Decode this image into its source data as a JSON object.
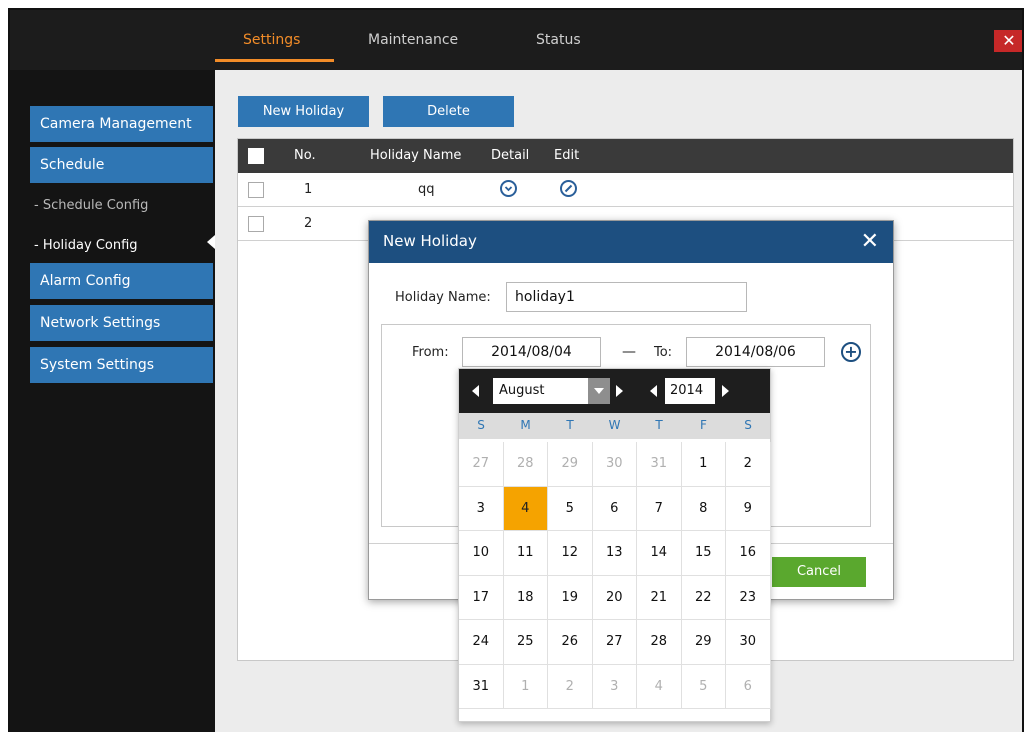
{
  "topbar": {
    "tabs": [
      "Settings",
      "Maintenance",
      "Status"
    ],
    "active_tab": "Settings",
    "close_label": "✕"
  },
  "sidebar": {
    "items": [
      {
        "label": "Camera Management"
      },
      {
        "label": "Schedule"
      },
      {
        "label": "- Schedule Config"
      },
      {
        "label": "- Holiday Config"
      },
      {
        "label": "Alarm Config"
      },
      {
        "label": "Network Settings"
      },
      {
        "label": "System Settings"
      }
    ]
  },
  "toolbar": {
    "new_holiday": "New Holiday",
    "delete": "Delete"
  },
  "table": {
    "headers": [
      "No.",
      "Holiday Name",
      "Detail",
      "Edit"
    ],
    "rows": [
      {
        "no": "1",
        "name": "qq"
      },
      {
        "no": "2",
        "name": ""
      }
    ]
  },
  "modal": {
    "title": "New Holiday",
    "close": "✕",
    "name_label": "Holiday Name:",
    "name_value": "holiday1",
    "from_label": "From:",
    "from_value": "2014/08/04",
    "dash": "—",
    "to_label": "To:",
    "to_value": "2014/08/06",
    "plus": "+",
    "cancel": "Cancel"
  },
  "calendar": {
    "month": "August",
    "year": "2014",
    "dow": [
      "S",
      "M",
      "T",
      "W",
      "T",
      "F",
      "S"
    ],
    "weeks": [
      [
        "27",
        "28",
        "29",
        "30",
        "31",
        "1",
        "2"
      ],
      [
        "3",
        "4",
        "5",
        "6",
        "7",
        "8",
        "9"
      ],
      [
        "10",
        "11",
        "12",
        "13",
        "14",
        "15",
        "16"
      ],
      [
        "17",
        "18",
        "19",
        "20",
        "21",
        "22",
        "23"
      ],
      [
        "24",
        "25",
        "26",
        "27",
        "28",
        "29",
        "30"
      ],
      [
        "31",
        "1",
        "2",
        "3",
        "4",
        "5",
        "6"
      ]
    ],
    "selected": "4",
    "accent": "#f5a300"
  },
  "colors": {
    "brand_blue": "#2f76b4",
    "header_dark": "#1c1c1c",
    "accent_orange": "#f28c28",
    "modal_blue": "#1d4f80",
    "cancel_green": "#5aa82e"
  }
}
